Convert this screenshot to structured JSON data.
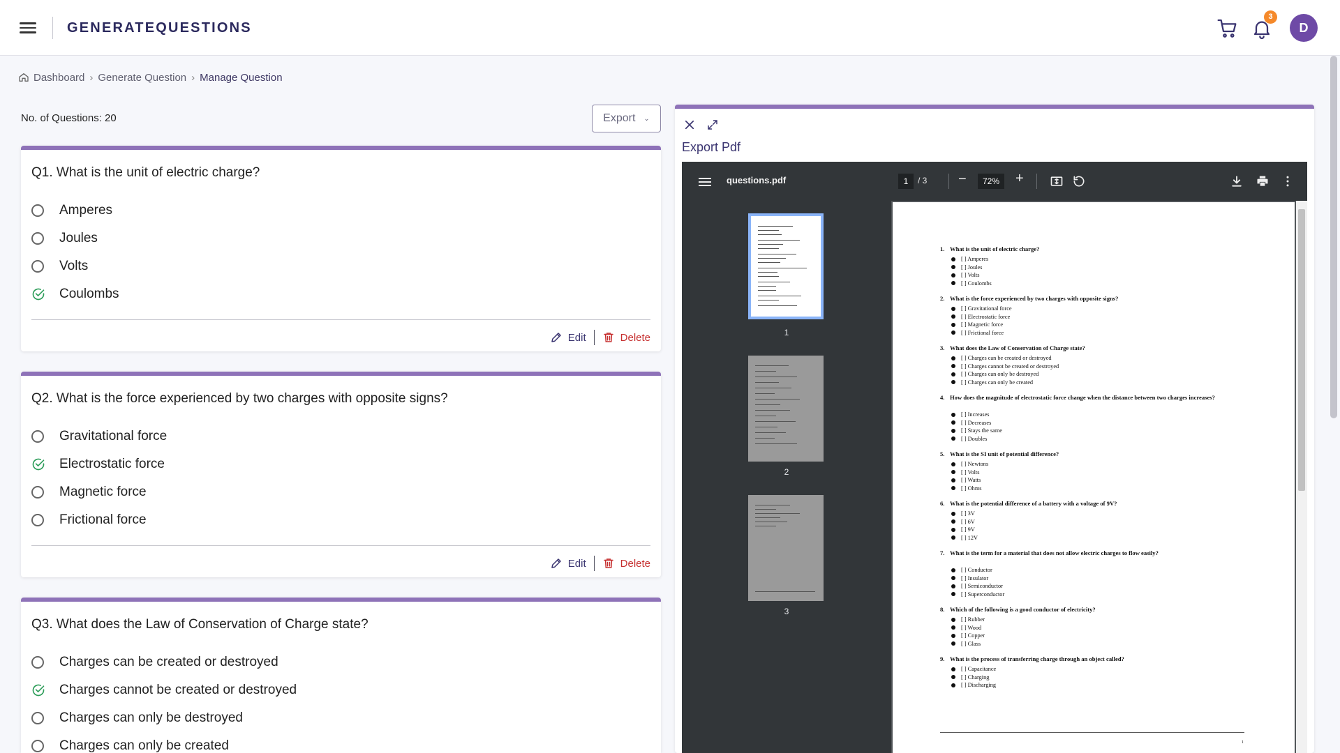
{
  "header": {
    "brand": "GENERATEQUESTIONS",
    "notifications_count": "3",
    "avatar_initial": "D"
  },
  "breadcrumb": [
    "Dashboard",
    "Generate Question",
    "Manage Question"
  ],
  "questions_count_label": "No. of Questions: 20",
  "export_label": "Export",
  "card_actions": {
    "edit": "Edit",
    "delete": "Delete"
  },
  "questions": [
    {
      "title": "Q1. What is the unit of electric charge?",
      "options": [
        {
          "text": "Amperes",
          "correct": false
        },
        {
          "text": "Joules",
          "correct": false
        },
        {
          "text": "Volts",
          "correct": false
        },
        {
          "text": "Coulombs",
          "correct": true
        }
      ]
    },
    {
      "title": "Q2. What is the force experienced by two charges with opposite signs?",
      "options": [
        {
          "text": "Gravitational force",
          "correct": false
        },
        {
          "text": "Electrostatic force",
          "correct": true
        },
        {
          "text": "Magnetic force",
          "correct": false
        },
        {
          "text": "Frictional force",
          "correct": false
        }
      ]
    },
    {
      "title": "Q3. What does the Law of Conservation of Charge state?",
      "options": [
        {
          "text": "Charges can be created or destroyed",
          "correct": false
        },
        {
          "text": "Charges cannot be created or destroyed",
          "correct": true
        },
        {
          "text": "Charges can only be destroyed",
          "correct": false
        },
        {
          "text": "Charges can only be created",
          "correct": false
        }
      ]
    }
  ],
  "panel": {
    "title": "Export Pdf"
  },
  "viewer": {
    "filename": "questions.pdf",
    "current_page": "1",
    "page_of": "/  3",
    "zoom": "72%",
    "thumb_labels": [
      "1",
      "2",
      "3"
    ],
    "page_number": "1",
    "pdf_questions": [
      {
        "num": "1.",
        "text": "What is the unit of electric charge?",
        "options": [
          "[ ] Amperes",
          "[ ] Joules",
          "[ ] Volts",
          "[ ] Coulombs"
        ]
      },
      {
        "num": "2.",
        "text": "What is the force experienced by two charges with opposite signs?",
        "options": [
          "[ ] Gravitational force",
          "[ ] Electrostatic force",
          "[ ] Magnetic force",
          "[ ] Frictional force"
        ]
      },
      {
        "num": "3.",
        "text": "What does the Law of Conservation of Charge state?",
        "options": [
          "[ ] Charges can be created or destroyed",
          "[ ] Charges cannot be created or destroyed",
          "[ ] Charges can only be destroyed",
          "[ ] Charges can only be created"
        ]
      },
      {
        "num": "4.",
        "text": "How does the magnitude of electrostatic force change when the distance between two charges increases?",
        "options": [
          "[ ] Increases",
          "[ ] Decreases",
          "[ ] Stays the same",
          "[ ] Doubles"
        ]
      },
      {
        "num": "5.",
        "text": "What is the SI unit of potential difference?",
        "options": [
          "[ ] Newtons",
          "[ ] Volts",
          "[ ] Watts",
          "[ ] Ohms"
        ]
      },
      {
        "num": "6.",
        "text": "What is the potential difference of a battery with a voltage of 9V?",
        "options": [
          "[ ] 3V",
          "[ ] 6V",
          "[ ] 9V",
          "[ ] 12V"
        ]
      },
      {
        "num": "7.",
        "text": "What is the term for a material that does not allow electric charges to flow easily?",
        "options": [
          "[ ] Conductor",
          "[ ] Insulator",
          "[ ] Semiconductor",
          "[ ] Superconductor"
        ]
      },
      {
        "num": "8.",
        "text": "Which of the following is a good conductor of electricity?",
        "options": [
          "[ ] Rubber",
          "[ ] Wood",
          "[ ] Copper",
          "[ ] Glass"
        ]
      },
      {
        "num": "9.",
        "text": "What is the process of transferring charge through an object called?",
        "options": [
          "[ ] Capacitance",
          "[ ] Charging",
          "[ ] Discharging"
        ]
      }
    ]
  },
  "colors": {
    "accent": "#8e72b8",
    "brand": "#2c2a5e",
    "delete": "#c62f2f",
    "correct": "#2e9d5a",
    "badge": "#f5892a"
  }
}
